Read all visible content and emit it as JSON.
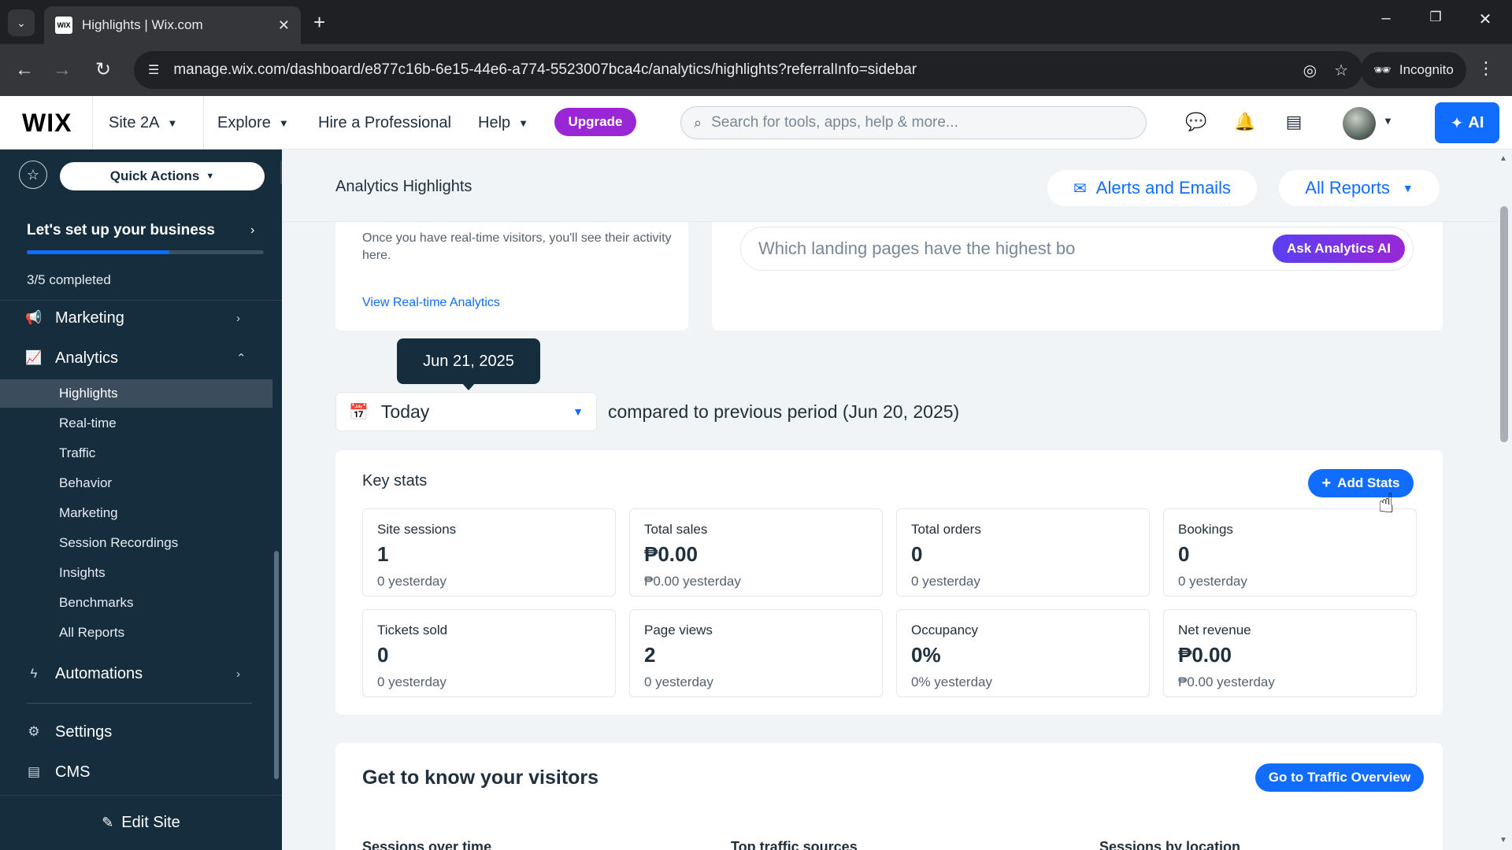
{
  "browser": {
    "tab_title": "Highlights | Wix.com",
    "favicon_text": "WIX",
    "url": "manage.wix.com/dashboard/e877c16b-6e15-44e6-a774-5523007bca4c/analytics/highlights?referralInfo=sidebar",
    "incognito_label": "Incognito"
  },
  "wixbar": {
    "logo": "WIX",
    "site_name": "Site 2A",
    "explore": "Explore",
    "hire": "Hire a Professional",
    "help": "Help",
    "upgrade": "Upgrade",
    "search_placeholder": "Search for tools, apps, help & more...",
    "ai_label": "AI"
  },
  "sidebar": {
    "quick_actions": "Quick Actions",
    "setup_title": "Let's set up your business",
    "setup_progress": 0.6,
    "setup_count": "3/5 completed",
    "marketing": "Marketing",
    "analytics": "Analytics",
    "analytics_items": [
      "Highlights",
      "Real-time",
      "Traffic",
      "Behavior",
      "Marketing",
      "Session Recordings",
      "Insights",
      "Benchmarks",
      "All Reports"
    ],
    "active_item": "Highlights",
    "automations": "Automations",
    "settings": "Settings",
    "cms": "CMS",
    "edit_site": "Edit Site"
  },
  "header": {
    "title": "Analytics Highlights",
    "alerts": "Alerts and Emails",
    "all_reports": "All Reports"
  },
  "realtime": {
    "text": "Once you have real-time visitors, you'll see their activity here.",
    "link": "View Real-time Analytics"
  },
  "ai_box": {
    "query": "Which landing pages have the highest bo",
    "button": "Ask Analytics AI"
  },
  "date": {
    "tooltip": "Jun 21, 2025",
    "selected": "Today",
    "compare": "compared to previous period (Jun 20, 2025)"
  },
  "key_stats": {
    "title": "Key stats",
    "add_button": "Add Stats",
    "stats": [
      {
        "label": "Site sessions",
        "value": "1",
        "prev": "0 yesterday"
      },
      {
        "label": "Total sales",
        "value": "₱0.00",
        "prev": "₱0.00 yesterday"
      },
      {
        "label": "Total orders",
        "value": "0",
        "prev": "0 yesterday"
      },
      {
        "label": "Bookings",
        "value": "0",
        "prev": "0 yesterday"
      },
      {
        "label": "Tickets sold",
        "value": "0",
        "prev": "0 yesterday"
      },
      {
        "label": "Page views",
        "value": "2",
        "prev": "0 yesterday"
      },
      {
        "label": "Occupancy",
        "value": "0%",
        "prev": "0% yesterday"
      },
      {
        "label": "Net revenue",
        "value": "₱0.00",
        "prev": "₱0.00 yesterday"
      }
    ]
  },
  "visitors": {
    "title": "Get to know your visitors",
    "button": "Go to Traffic Overview",
    "subheads": [
      "Sessions over time",
      "Top traffic sources",
      "Sessions by location"
    ]
  },
  "colors": {
    "accent": "#116dff",
    "upgrade": "#9a27d5",
    "sidebar_bg": "#162d3d"
  }
}
